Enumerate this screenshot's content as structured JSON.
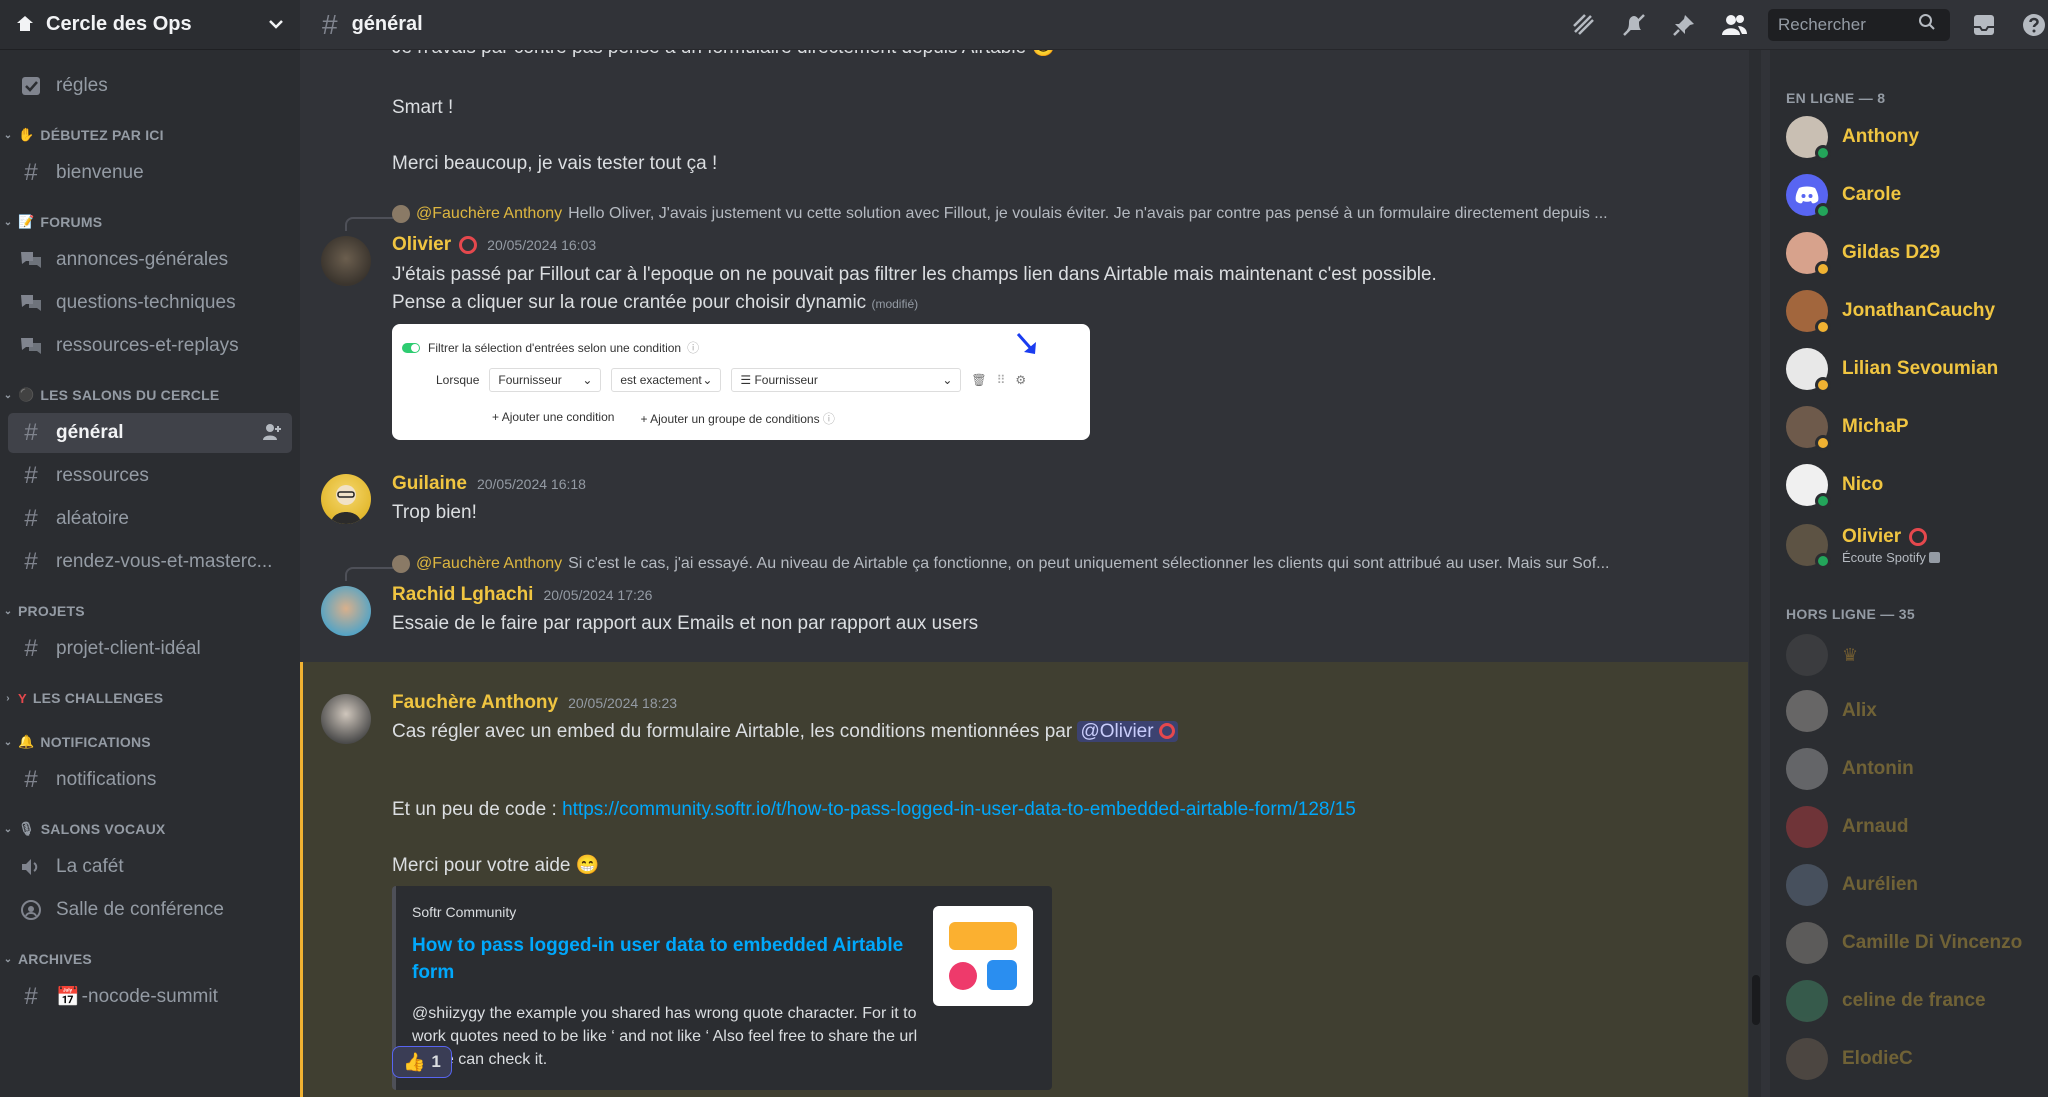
{
  "server": {
    "name": "Cercle des Ops"
  },
  "channels": {
    "rules": "régles",
    "cat_start": "DÉBUTEZ PAR ICI",
    "welcome": "bienvenue",
    "cat_forums": "FORUMS",
    "forum1": "annonces-générales",
    "forum2": "questions-techniques",
    "forum3": "ressources-et-replays",
    "cat_circle": "LES SALONS DU CERCLE",
    "general": "général",
    "resources": "ressources",
    "random": "aléatoire",
    "meetings": "rendez-vous-et-masterc...",
    "cat_projects": "PROJETS",
    "project": "projet-client-idéal",
    "cat_challenges": "LES CHALLENGES",
    "cat_notifications": "NOTIFICATIONS",
    "notifications": "notifications",
    "cat_voice": "SALONS VOCAUX",
    "voice1": "La cafét",
    "voice2": "Salle de conférence",
    "cat_archives": "ARCHIVES",
    "archive1": "-nocode-summit"
  },
  "topbar": {
    "channel": "général",
    "search_placeholder": "Rechercher"
  },
  "messages": {
    "m0_text": "Je n'avais par contre pas pensé à un formulaire directement depuis Airtable",
    "m0b": "Smart !",
    "m0c": "Merci beaucoup, je vais tester tout ça !",
    "r1_name": "@Fauchère Anthony",
    "r1_text": "Hello Oliver,  J'avais justement vu cette solution avec Fillout, je voulais éviter.   Je n'avais par contre pas pensé à un formulaire directement depuis ...",
    "m1_user": "Olivier",
    "m1_ts": "20/05/2024 16:03",
    "m1_line1": "J'étais passé par Fillout car à l'epoque on ne pouvait pas filtrer les champs lien dans Airtable mais maintenant c'est possible.",
    "m1_line2": "Pense a cliquer sur la roue crantée pour choisir dynamic",
    "m1_edited": "(modifié)",
    "emb_toggle": "Filtrer la sélection d'entrées selon une condition",
    "emb_when": "Lorsque",
    "emb_field": "Fournisseur",
    "emb_op": "est exactement",
    "emb_val": "Fournisseur",
    "emb_add": "Ajouter une condition",
    "emb_group": "Ajouter un groupe de conditions",
    "m2_user": "Guilaine",
    "m2_ts": "20/05/2024 16:18",
    "m2_text": "Trop bien!",
    "r3_name": "@Fauchère Anthony",
    "r3_text": "Si c'est le cas, j'ai essayé.  Au niveau de Airtable ça fonctionne, on peut uniquement sélectionner les clients qui sont attribué au user.   Mais sur Sof...",
    "m3_user": "Rachid Lghachi",
    "m3_ts": "20/05/2024 17:26",
    "m3_text": "Essaie de le faire par rapport aux Emails et non par rapport aux users",
    "m4_user": "Fauchère Anthony",
    "m4_ts": "20/05/2024 18:23",
    "m4_text": "Cas régler avec un embed du formulaire Airtable, les conditions mentionnées par",
    "m4_mention": "@Olivier",
    "m4_code": "Et un peu de code :",
    "m4_link": "https://community.softr.io/t/how-to-pass-logged-in-user-data-to-embedded-airtable-form/128/15",
    "m4_thanks": "Merci pour votre aide",
    "card_site": "Softr Community",
    "card_title": "How to pass logged-in user data to embedded Airtable form",
    "card_desc": "@shiizygy the example you shared has wrong quote character. For it to work quotes need to be like ‘ and not like ‘ Also feel free to share the url so we can check it.",
    "reaction_count": "1"
  },
  "members": {
    "online_label": "EN LIGNE — 8",
    "offline_label": "HORS LIGNE — 35",
    "online": [
      "Anthony",
      "Carole",
      "Gildas D29",
      "JonathanCauchy",
      "Lilian Sevoumian",
      "MichaP",
      "Nico",
      "Olivier"
    ],
    "olivier_status": "Écoute Spotify",
    "offline": [
      "Alix",
      "Antonin",
      "Arnaud",
      "Aurélien",
      "Camille Di Vincenzo",
      "celine de france",
      "ElodieC"
    ]
  },
  "colors": {
    "accent": "#f0c541",
    "link": "#00a8fc",
    "online": "#23a55a",
    "idle": "#f0b232"
  }
}
